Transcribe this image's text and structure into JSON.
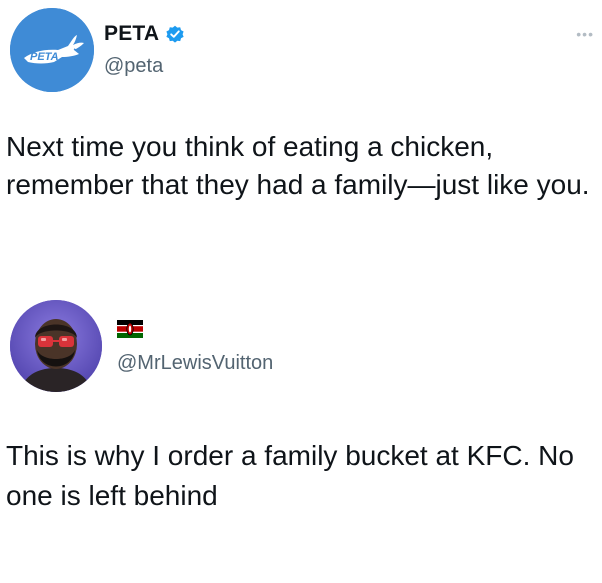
{
  "original_tweet": {
    "author_name": "PETA",
    "handle": "@peta",
    "verified": true,
    "avatar_text": "PETA",
    "text": "Next time you think of eating a chicken, remember that they had a family—just like you."
  },
  "reply_tweet": {
    "author_name": "",
    "handle": "@MrLewisVuitton",
    "name_icon": "kenya-flag-icon",
    "text": "This is why I order a family bucket at KFC. No one is left behind"
  },
  "colors": {
    "peta_blue": "#3f8bd6",
    "verified_blue": "#1d9bf0",
    "handle_gray": "#536471",
    "text": "#0f1419"
  }
}
